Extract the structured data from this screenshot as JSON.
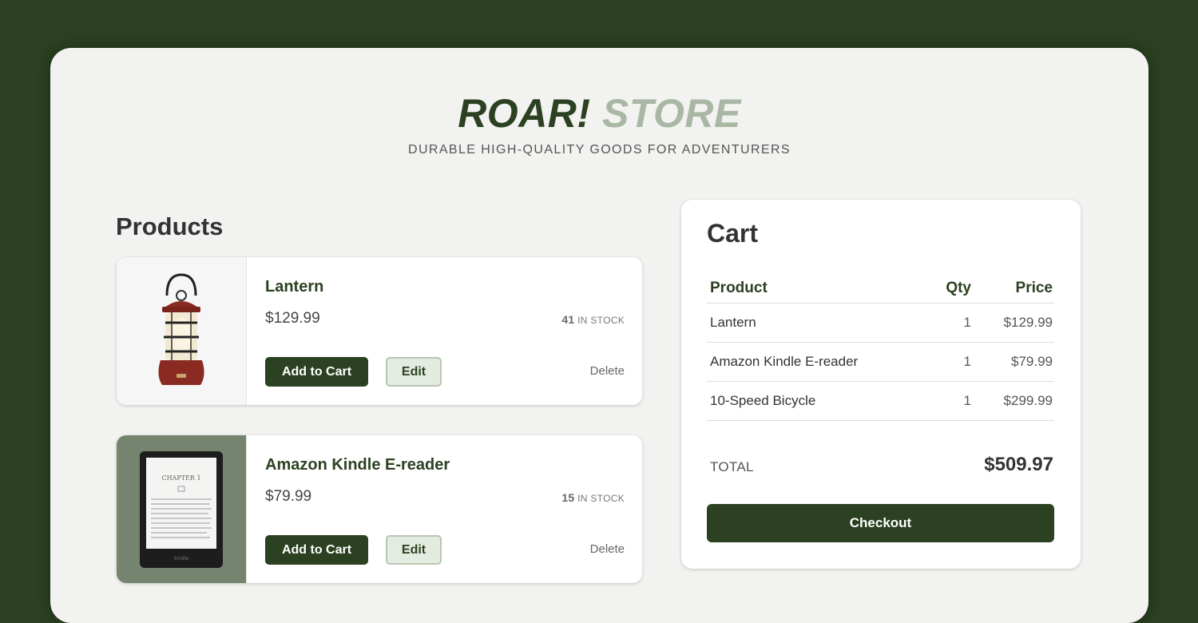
{
  "brand": {
    "title_part1": "ROAR!",
    "title_part2": "STORE",
    "tagline": "DURABLE HIGH-QUALITY GOODS FOR ADVENTURERS"
  },
  "products": {
    "heading": "Products",
    "items": [
      {
        "name": "Lantern",
        "price": "$129.99",
        "stock_count": "41",
        "stock_label": "IN STOCK",
        "image_icon": "lantern-icon",
        "add_label": "Add to Cart",
        "edit_label": "Edit",
        "delete_label": "Delete"
      },
      {
        "name": "Amazon Kindle E-reader",
        "price": "$79.99",
        "stock_count": "15",
        "stock_label": "IN STOCK",
        "image_icon": "kindle-icon",
        "add_label": "Add to Cart",
        "edit_label": "Edit",
        "delete_label": "Delete"
      }
    ]
  },
  "cart": {
    "title": "Cart",
    "columns": {
      "product": "Product",
      "qty": "Qty",
      "price": "Price"
    },
    "items": [
      {
        "product": "Lantern",
        "qty": "1",
        "price": "$129.99"
      },
      {
        "product": "Amazon Kindle E-reader",
        "qty": "1",
        "price": "$79.99"
      },
      {
        "product": "10-Speed Bicycle",
        "qty": "1",
        "price": "$299.99"
      }
    ],
    "total_label": "TOTAL",
    "total_value": "$509.97",
    "checkout_label": "Checkout"
  },
  "colors": {
    "background": "#2b4121",
    "primary": "#2b4121",
    "accent_light": "#a9b8a4",
    "panel": "#f2f2f0"
  }
}
